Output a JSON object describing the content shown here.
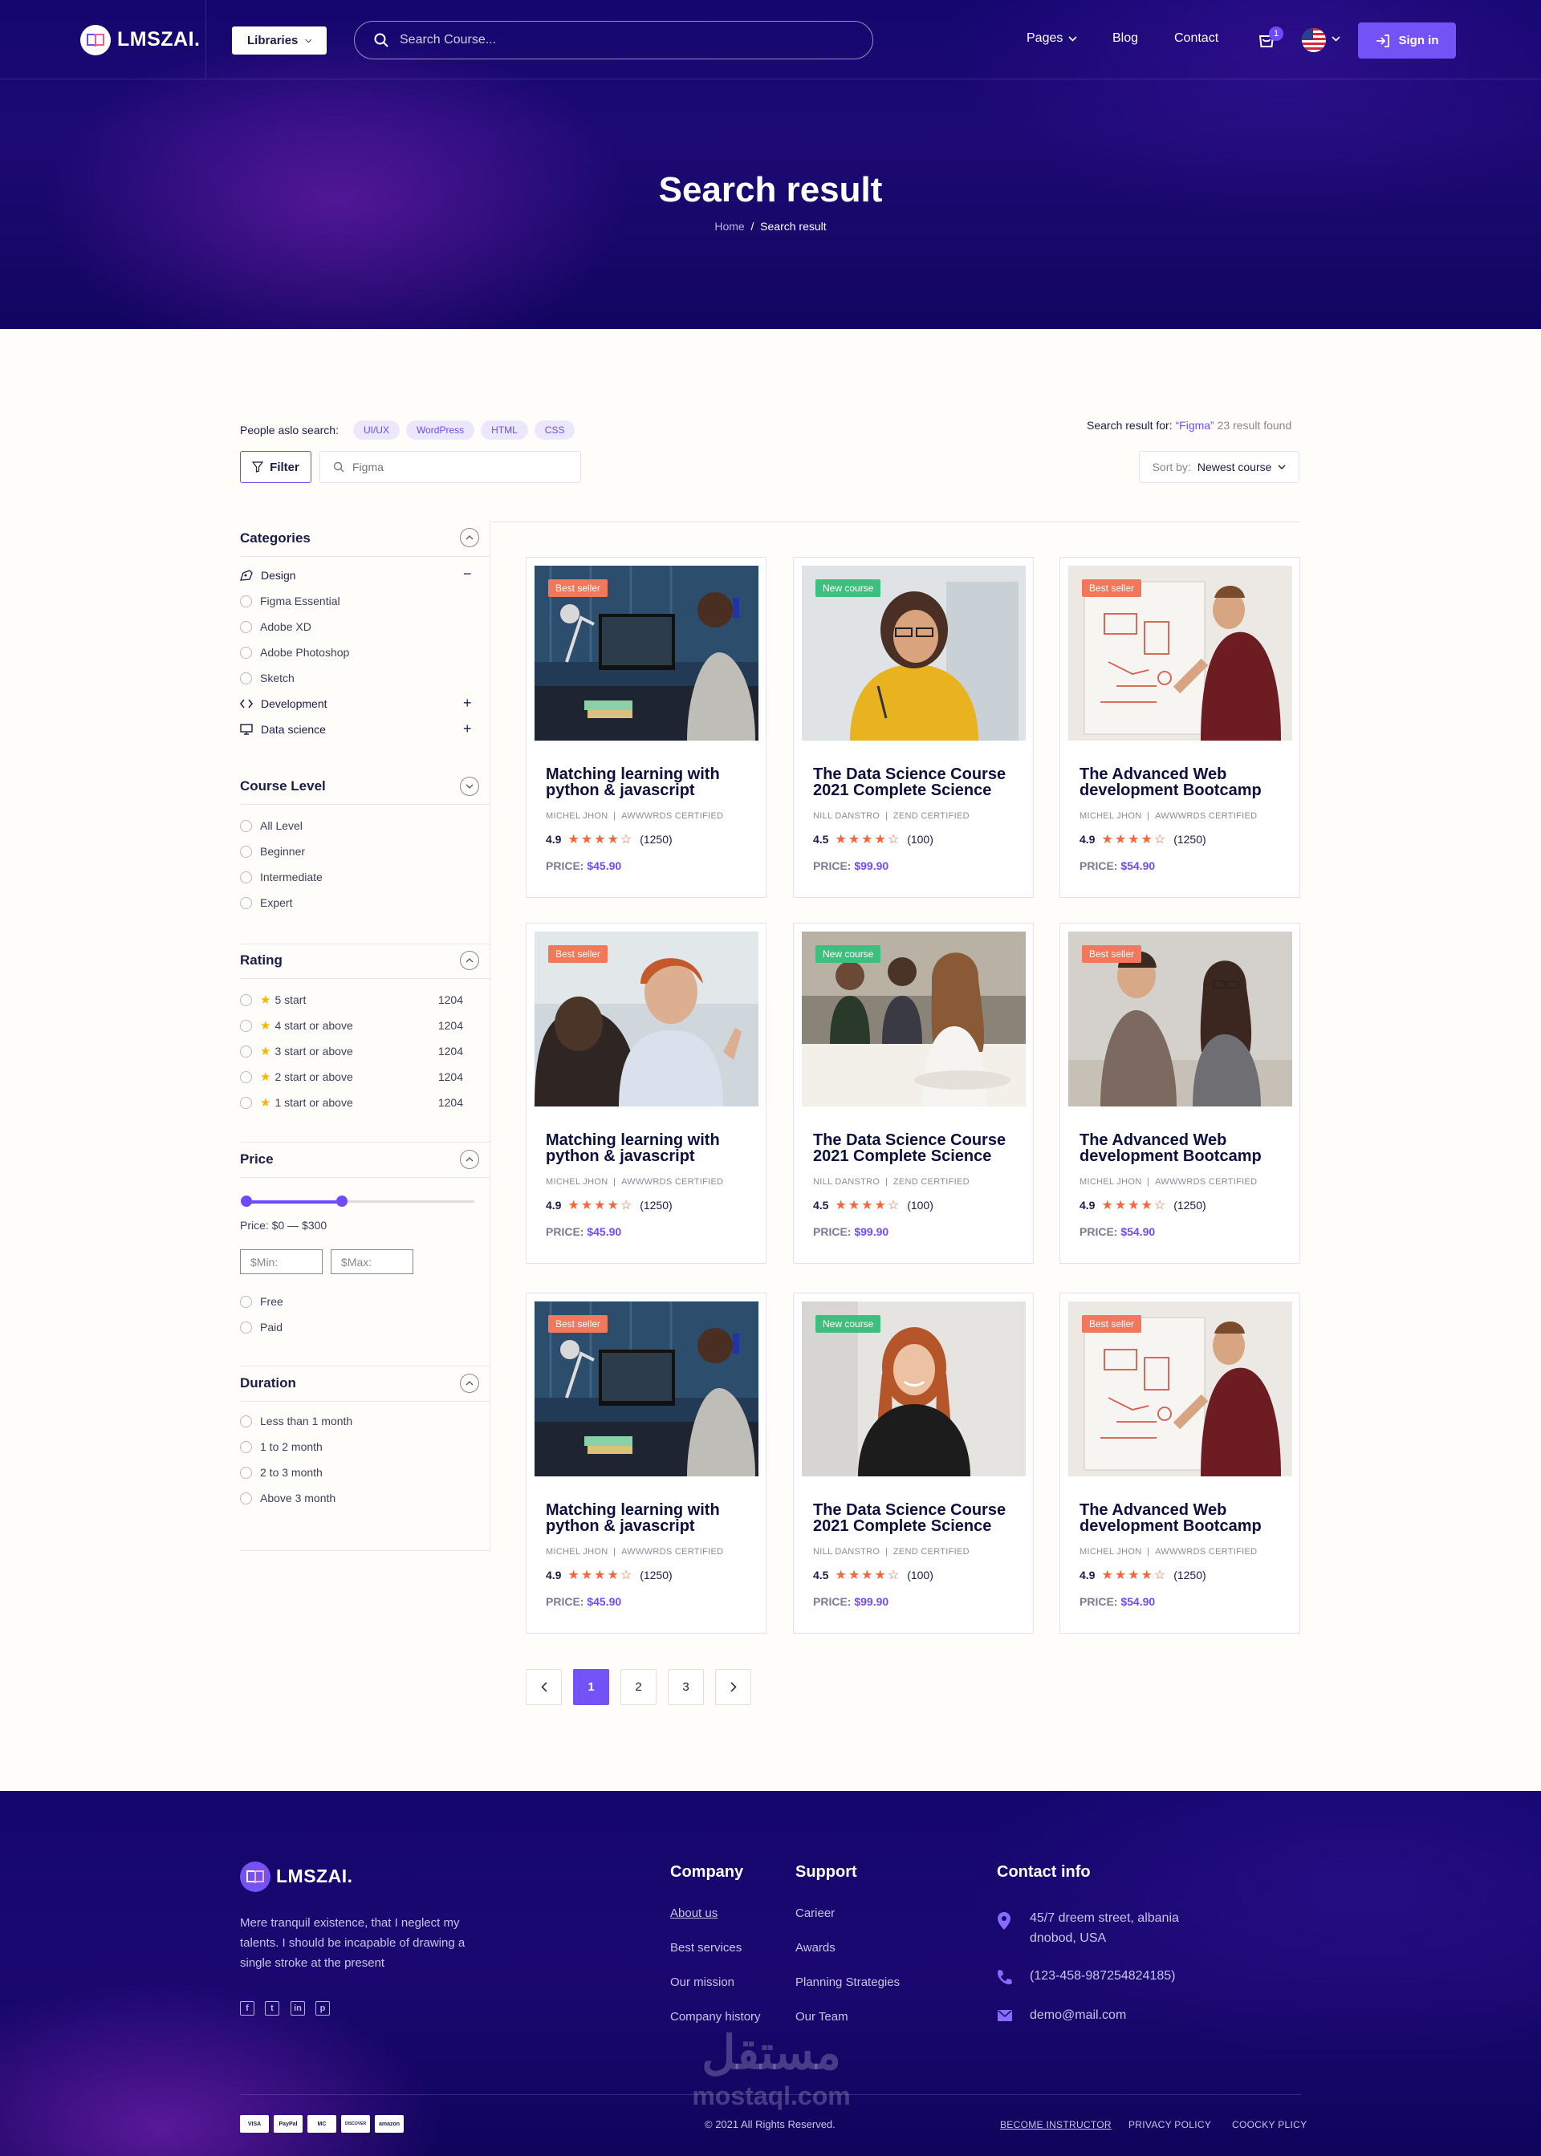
{
  "header": {
    "brand": "LMSZAI.",
    "libraries_label": "Libraries",
    "search_placeholder": "Search Course...",
    "nav": {
      "pages": "Pages",
      "blog": "Blog",
      "contact": "Contact"
    },
    "cart_count": "1",
    "signin_label": "Sign in"
  },
  "hero": {
    "title": "Search result",
    "breadcrumb_home": "Home",
    "breadcrumb_sep": "/",
    "breadcrumb_current": "Search result"
  },
  "search_bar": {
    "people_label": "People aslo search:",
    "tags": [
      "UI/UX",
      "WordPress",
      "HTML",
      "CSS"
    ],
    "result_label": "Search result for:",
    "result_query": "“Figma”",
    "result_count": "23 result found",
    "filter_label": "Filter",
    "filter_query": "Figma",
    "sort_label": "Sort by:",
    "sort_value": "Newest course"
  },
  "sidebar": {
    "categories": {
      "title": "Categories",
      "design": "Design",
      "subitems": [
        "Figma Essential",
        "Adobe XD",
        "Adobe Photoshop",
        "Sketch"
      ],
      "development": "Development",
      "data_science": "Data science"
    },
    "level": {
      "title": "Course Level",
      "items": [
        "All Level",
        "Beginner",
        "Intermediate",
        "Expert"
      ]
    },
    "rating": {
      "title": "Rating",
      "items": [
        {
          "label": "5 start",
          "count": "1204"
        },
        {
          "label": "4 start or above",
          "count": "1204"
        },
        {
          "label": "3 start or above",
          "count": "1204"
        },
        {
          "label": "2 start or above",
          "count": "1204"
        },
        {
          "label": "1 start or above",
          "count": "1204"
        }
      ]
    },
    "price": {
      "title": "Price",
      "range_text": "Price: $0 — $300",
      "min_placeholder": "$Min:",
      "max_placeholder": "$Max:",
      "options": [
        "Free",
        "Paid"
      ]
    },
    "duration": {
      "title": "Duration",
      "items": [
        "Less than 1 month",
        "1 to 2 month",
        "2 to 3 month",
        "Above 3 month"
      ]
    }
  },
  "courses": [
    {
      "badge": "Best seller",
      "title": "Matching learning with python & javascript",
      "author": "MICHEL JHON",
      "org": "AWWWRDS CERTIFIED",
      "rating": "4.9",
      "reviews": "(1250)",
      "price_label": "PRICE:",
      "price": "$45.90"
    },
    {
      "badge": "New course",
      "title": "The Data Science Course 2021 Complete Science",
      "author": "NILL DANSTRO",
      "org": "ZEND CERTIFIED",
      "rating": "4.5",
      "reviews": "(100)",
      "price_label": "PRICE:",
      "price": "$99.90"
    },
    {
      "badge": "Best seller",
      "title": "The Advanced Web development Bootcamp",
      "author": "MICHEL JHON",
      "org": "AWWWRDS CERTIFIED",
      "rating": "4.9",
      "reviews": "(1250)",
      "price_label": "PRICE:",
      "price": "$54.90"
    },
    {
      "badge": "Best seller",
      "title": "Matching learning with python & javascript",
      "author": "MICHEL JHON",
      "org": "AWWWRDS CERTIFIED",
      "rating": "4.9",
      "reviews": "(1250)",
      "price_label": "PRICE:",
      "price": "$45.90"
    },
    {
      "badge": "New course",
      "title": "The Data Science Course 2021 Complete Science",
      "author": "NILL DANSTRO",
      "org": "ZEND CERTIFIED",
      "rating": "4.5",
      "reviews": "(100)",
      "price_label": "PRICE:",
      "price": "$99.90"
    },
    {
      "badge": "Best seller",
      "title": "The Advanced Web development Bootcamp",
      "author": "MICHEL JHON",
      "org": "AWWWRDS CERTIFIED",
      "rating": "4.9",
      "reviews": "(1250)",
      "price_label": "PRICE:",
      "price": "$54.90"
    },
    {
      "badge": "Best seller",
      "title": "Matching learning with python & javascript",
      "author": "MICHEL JHON",
      "org": "AWWWRDS CERTIFIED",
      "rating": "4.9",
      "reviews": "(1250)",
      "price_label": "PRICE:",
      "price": "$45.90"
    },
    {
      "badge": "New course",
      "title": "The Data Science Course 2021 Complete Science",
      "author": "NILL DANSTRO",
      "org": "ZEND CERTIFIED",
      "rating": "4.5",
      "reviews": "(100)",
      "price_label": "PRICE:",
      "price": "$99.90"
    },
    {
      "badge": "Best seller",
      "title": "The Advanced Web development Bootcamp",
      "author": "MICHEL JHON",
      "org": "AWWWRDS CERTIFIED",
      "rating": "4.9",
      "reviews": "(1250)",
      "price_label": "PRICE:",
      "price": "$54.90"
    }
  ],
  "pagination": {
    "pages": [
      "1",
      "2",
      "3"
    ],
    "current": "1"
  },
  "footer": {
    "brand": "LMSZAI.",
    "about": "Mere tranquil existence, that I neglect my talents. I should be incapable of drawing a single stroke at the present",
    "company_title": "Company",
    "company_links": [
      "About us",
      "Best services",
      "Our mission",
      "Company history"
    ],
    "support_title": "Support",
    "support_links": [
      "Carieer",
      "Awards",
      "Planning Strategies",
      "Our Team"
    ],
    "contact_title": "Contact info",
    "address_line1": "45/7 dreem street, albania",
    "address_line2": "dnobod, USA",
    "phone": "(123-458-987254824185)",
    "email": "demo@mail.com",
    "copyright": "© 2021  All Rights Reserved.",
    "bottom_links": [
      "BECOME INSTRUCTOR",
      "PRIVACY POLICY",
      "COOCKY PLICY"
    ],
    "payment": [
      "VISA",
      "PayPal",
      "MC",
      "DISCOVER",
      "amazon"
    ],
    "watermark_ar": "مستقل",
    "watermark": "mostaql.com"
  },
  "colors": {
    "primary": "#7453f6",
    "header_bg": "#14066e",
    "badge_best": "#f2785c",
    "badge_new": "#3fbf7f",
    "star_rating": "#f2673d",
    "star_filter": "#f7b500"
  }
}
